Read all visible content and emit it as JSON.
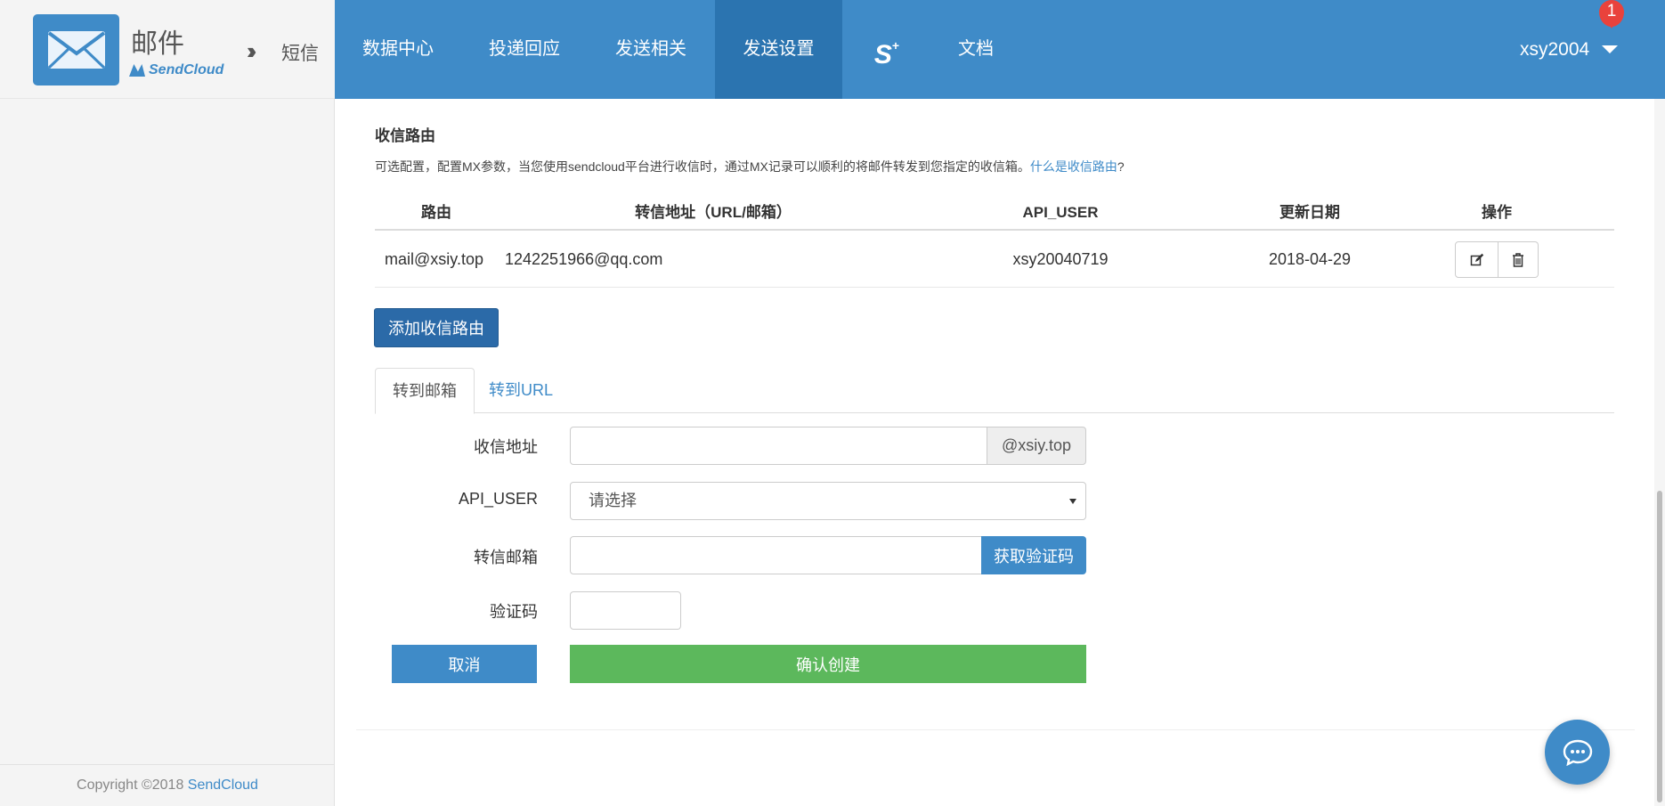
{
  "brand": {
    "title": "邮件",
    "subtitle": "SendCloud",
    "switch_label": "短信",
    "accent_color": "#3f8bc8"
  },
  "nav": {
    "items": [
      {
        "label": "数据中心",
        "active": false
      },
      {
        "label": "投递回应",
        "active": false
      },
      {
        "label": "发送相关",
        "active": false
      },
      {
        "label": "发送设置",
        "active": true
      },
      {
        "label": "S",
        "sup": "+",
        "active": false
      },
      {
        "label": "文档",
        "active": false
      }
    ],
    "user": "xsy2004",
    "notification_count": "1"
  },
  "sidebar": {
    "copyright_prefix": "Copyright ©2018 ",
    "copyright_link": "SendCloud"
  },
  "section": {
    "title": "收信路由",
    "description": "可选配置，配置MX参数，当您使用sendcloud平台进行收信时，通过MX记录可以顺利的将邮件转发到您指定的收信箱。",
    "help_link": "什么是收信路由",
    "help_suffix": "?"
  },
  "table": {
    "headers": [
      "路由",
      "转信地址（URL/邮箱）",
      "API_USER",
      "更新日期",
      "操作"
    ],
    "rows": [
      {
        "route": "mail@xsiy.top",
        "forward": "1242251966@qq.com",
        "api_user": "xsy20040719",
        "date": "2018-04-29"
      }
    ]
  },
  "add_button": "添加收信路由",
  "tabs": [
    {
      "label": "转到邮箱",
      "active": true
    },
    {
      "label": "转到URL",
      "active": false
    }
  ],
  "form": {
    "address_label": "收信地址",
    "address_value": "",
    "address_suffix": "@xsiy.top",
    "api_user_label": "API_USER",
    "api_user_selected": "请选择",
    "forward_label": "转信邮箱",
    "forward_value": "",
    "get_code_button": "获取验证码",
    "code_label": "验证码",
    "code_value": "",
    "cancel_button": "取消",
    "confirm_button": "确认创建"
  },
  "icons": {
    "edit": "edit-icon",
    "delete": "trash-icon",
    "chat": "chat-bubble-icon",
    "logo": "envelope-icon"
  }
}
